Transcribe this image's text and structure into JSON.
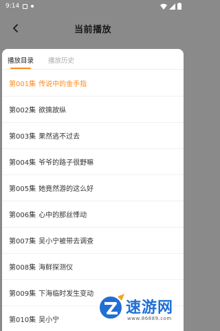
{
  "status_bar": {
    "time": "9:14"
  },
  "header": {
    "title": "当前播放"
  },
  "tabs": [
    {
      "label": "播放目录",
      "active": true
    },
    {
      "label": "播放历史",
      "active": false
    }
  ],
  "episodes": [
    {
      "num": "第001集",
      "title": "传说中的金手指",
      "active": true
    },
    {
      "num": "第002集",
      "title": "欲擒故纵",
      "active": false
    },
    {
      "num": "第003集",
      "title": "果然逃不过去",
      "active": false
    },
    {
      "num": "第004集",
      "title": "爷爷的路子很野嘛",
      "active": false
    },
    {
      "num": "第005集",
      "title": "她竟然游的这么好",
      "active": false
    },
    {
      "num": "第006集",
      "title": "心中的那丝悸动",
      "active": false
    },
    {
      "num": "第007集",
      "title": "吴小宁被带去调查",
      "active": false
    },
    {
      "num": "第008集",
      "title": "海鲜探测仪",
      "active": false
    },
    {
      "num": "第009集",
      "title": "下海临时发生变动",
      "active": false
    },
    {
      "num": "第010集",
      "title": "吴小宁",
      "active": false
    }
  ],
  "watermark": {
    "brand": "速游网",
    "url": "www.86889.com"
  },
  "colors": {
    "accent": "#ff8a1e",
    "overlay": "#8a8a8a"
  }
}
